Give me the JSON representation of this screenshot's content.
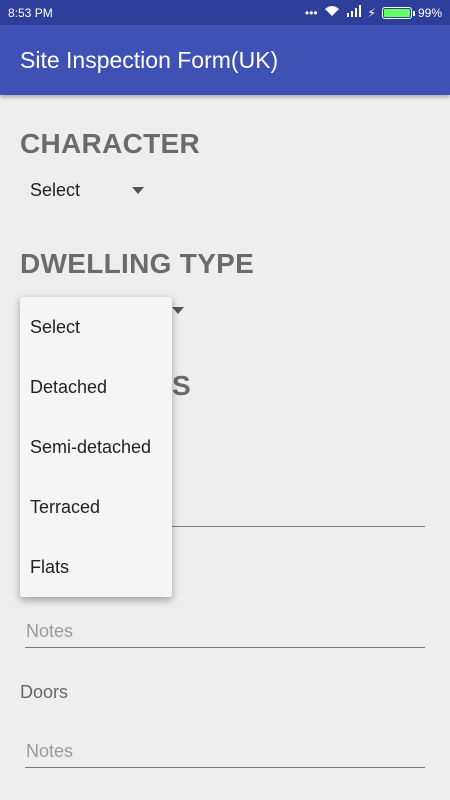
{
  "status_bar": {
    "time": "8:53 PM",
    "battery_percent": "99%",
    "battery_level": 0.99
  },
  "app": {
    "title": "Site Inspection Form(UK)"
  },
  "character": {
    "title": "CHARACTER",
    "selected": "Select"
  },
  "dwelling_type": {
    "title": "DWELLING TYPE",
    "options": [
      "Select",
      "Detached",
      "Semi-detached",
      "Terraced",
      "Flats"
    ]
  },
  "hidden_fragment": "S",
  "fields": {
    "notes_placeholder_1": "Notes",
    "doors_label": "Doors",
    "notes_placeholder_2": "Notes"
  }
}
